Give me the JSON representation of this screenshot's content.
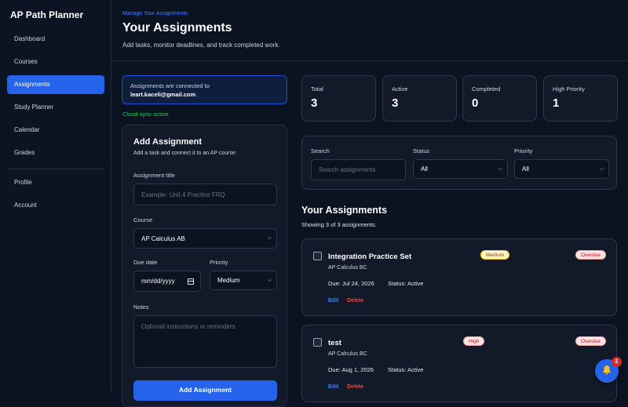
{
  "app": {
    "title": "AP Path Planner"
  },
  "sidebar": {
    "items": [
      {
        "label": "Dashboard"
      },
      {
        "label": "Courses"
      },
      {
        "label": "Assignments"
      },
      {
        "label": "Study Planner"
      },
      {
        "label": "Calendar"
      },
      {
        "label": "Grades"
      },
      {
        "label": "Profile"
      },
      {
        "label": "Account"
      }
    ],
    "active_index": 2
  },
  "header": {
    "eyebrow": "Manage Your Assignments",
    "title": "Your Assignments",
    "subtitle": "Add tasks, monitor deadlines, and track completed work."
  },
  "sync": {
    "prefix": "Assignments are connected to",
    "email": "leart.kaceli@gmail.com",
    "suffix": ".",
    "status": "Cloud sync active"
  },
  "add_form": {
    "title": "Add Assignment",
    "subtitle": "Add a task and connect it to an AP course.",
    "title_label": "Assignment title",
    "title_placeholder": "Example: Unit 4 Practice FRQ",
    "course_label": "Course",
    "course_value": "AP Calculus AB",
    "due_label": "Due date",
    "due_placeholder": "mm/dd/yyyy",
    "priority_label": "Priority",
    "priority_value": "Medium",
    "notes_label": "Notes",
    "notes_placeholder": "Optional instructions or reminders",
    "submit_label": "Add Assignment"
  },
  "stats": [
    {
      "label": "Total",
      "value": "3"
    },
    {
      "label": "Active",
      "value": "3"
    },
    {
      "label": "Completed",
      "value": "0"
    },
    {
      "label": "High Priority",
      "value": "1"
    }
  ],
  "filters": {
    "search_label": "Search",
    "search_placeholder": "Search assignments",
    "status_label": "Status",
    "status_value": "All",
    "priority_label": "Priority",
    "priority_value": "All"
  },
  "list": {
    "title": "Your Assignments",
    "count_text": "Showing 3 of 3 assignments.",
    "items": [
      {
        "title": "Integration Practice Set",
        "course": "AP Calculus BC",
        "due": "Due: Jul 24, 2026",
        "status": "Status: Active",
        "priority_badge": "Medium",
        "state_badge": "Overdue",
        "edit": "Edit",
        "delete": "Delete"
      },
      {
        "title": "test",
        "course": "AP Calculus BC",
        "due": "Due: Aug 1, 2026",
        "status": "Status: Active",
        "priority_badge": "High",
        "state_badge": "Overdue",
        "edit": "Edit",
        "delete": "Delete"
      }
    ]
  },
  "notifications": {
    "count": "2"
  }
}
